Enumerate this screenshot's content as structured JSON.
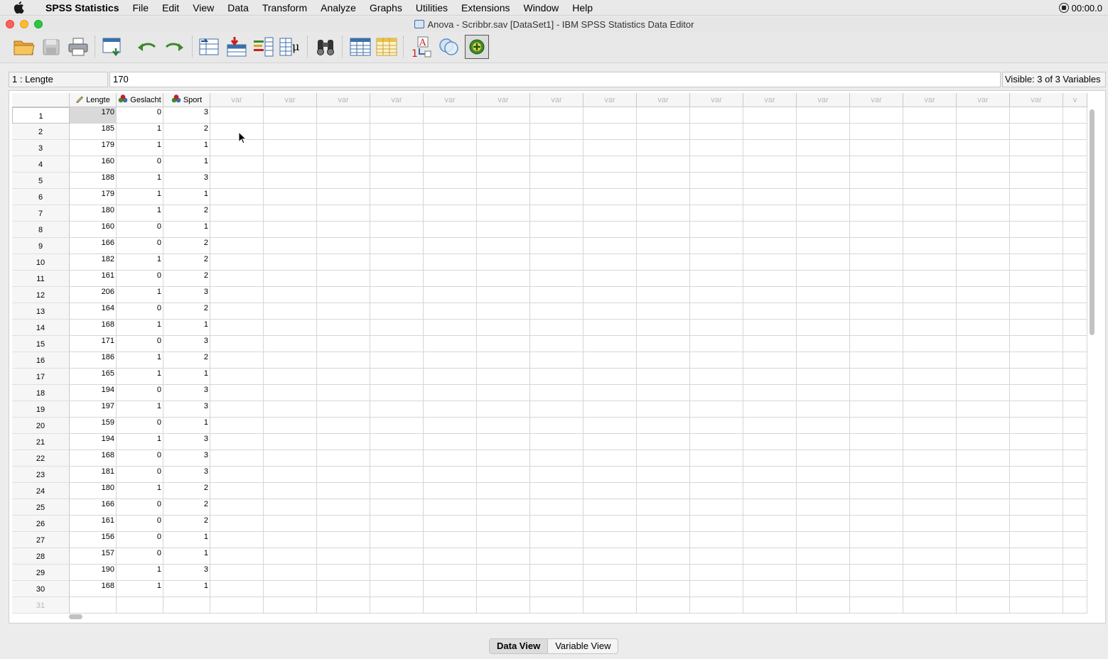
{
  "menubar": {
    "app_name": "SPSS Statistics",
    "items": [
      "File",
      "Edit",
      "View",
      "Data",
      "Transform",
      "Analyze",
      "Graphs",
      "Utilities",
      "Extensions",
      "Window",
      "Help"
    ],
    "clock": "00:00.0"
  },
  "window": {
    "title": "Anova - Scribbr.sav [DataSet1] - IBM SPSS Statistics Data Editor"
  },
  "toolbar": {
    "buttons": [
      "open-folder-icon",
      "save-icon",
      "print-icon",
      "recall-dialog-icon",
      "undo-icon",
      "redo-icon",
      "goto-case-icon",
      "goto-variable-icon",
      "variables-icon",
      "descriptives-icon",
      "find-icon",
      "insert-cases-icon",
      "split-file-icon",
      "value-labels-icon",
      "use-sets-icon",
      "extensions-icon"
    ]
  },
  "cellbar": {
    "reference": "1 : Lengte",
    "value": "170",
    "visible": "Visible: 3 of 3 Variables"
  },
  "grid": {
    "columns": [
      "Lengte",
      "Geslacht",
      "Sport"
    ],
    "empty_column_label": "var",
    "empty_column_partial": "v",
    "rows": [
      [
        "170",
        "0",
        "3"
      ],
      [
        "185",
        "1",
        "2"
      ],
      [
        "179",
        "1",
        "1"
      ],
      [
        "160",
        "0",
        "1"
      ],
      [
        "188",
        "1",
        "3"
      ],
      [
        "179",
        "1",
        "1"
      ],
      [
        "180",
        "1",
        "2"
      ],
      [
        "160",
        "0",
        "1"
      ],
      [
        "166",
        "0",
        "2"
      ],
      [
        "182",
        "1",
        "2"
      ],
      [
        "161",
        "0",
        "2"
      ],
      [
        "206",
        "1",
        "3"
      ],
      [
        "164",
        "0",
        "2"
      ],
      [
        "168",
        "1",
        "1"
      ],
      [
        "171",
        "0",
        "3"
      ],
      [
        "186",
        "1",
        "2"
      ],
      [
        "165",
        "1",
        "1"
      ],
      [
        "194",
        "0",
        "3"
      ],
      [
        "197",
        "1",
        "3"
      ],
      [
        "159",
        "0",
        "1"
      ],
      [
        "194",
        "1",
        "3"
      ],
      [
        "168",
        "0",
        "3"
      ],
      [
        "181",
        "0",
        "3"
      ],
      [
        "180",
        "1",
        "2"
      ],
      [
        "166",
        "0",
        "2"
      ],
      [
        "161",
        "0",
        "2"
      ],
      [
        "156",
        "0",
        "1"
      ],
      [
        "157",
        "0",
        "1"
      ],
      [
        "190",
        "1",
        "3"
      ],
      [
        "168",
        "1",
        "1"
      ]
    ],
    "next_row_number": "31"
  },
  "tabs": {
    "data_view": "Data View",
    "variable_view": "Variable View"
  },
  "colors": {
    "menubar_bg": "#e9e9e9",
    "selected_cell": "#d9d9d9",
    "var_text": "#b8b8b8"
  }
}
